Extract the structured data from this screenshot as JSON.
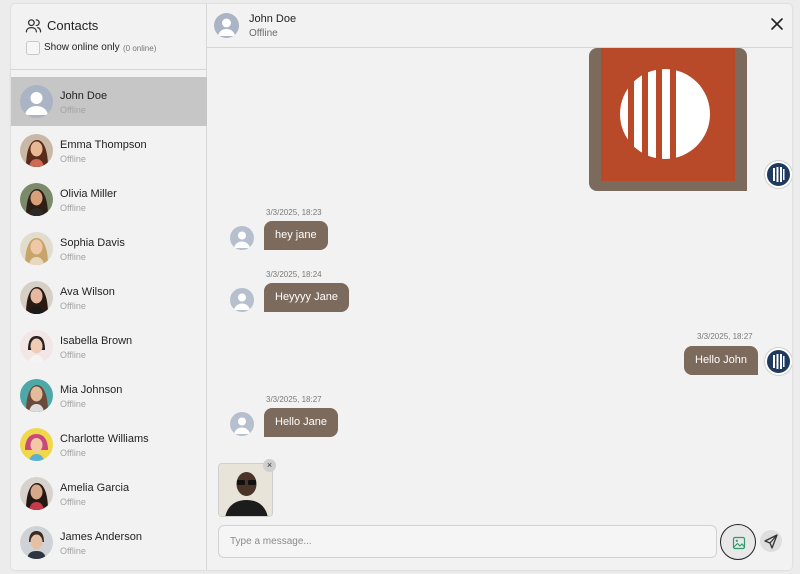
{
  "sidebar": {
    "title": "Contacts",
    "filter_label": "Show online only",
    "online_count": "(0 online)",
    "contacts": [
      {
        "name": "John Doe",
        "status": "Offline"
      },
      {
        "name": "Emma Thompson",
        "status": "Offline"
      },
      {
        "name": "Olivia Miller",
        "status": "Offline"
      },
      {
        "name": "Sophia Davis",
        "status": "Offline"
      },
      {
        "name": "Ava Wilson",
        "status": "Offline"
      },
      {
        "name": "Isabella Brown",
        "status": "Offline"
      },
      {
        "name": "Mia Johnson",
        "status": "Offline"
      },
      {
        "name": "Charlotte Williams",
        "status": "Offline"
      },
      {
        "name": "Amelia Garcia",
        "status": "Offline"
      },
      {
        "name": "James Anderson",
        "status": "Offline"
      }
    ]
  },
  "chat": {
    "name": "John Doe",
    "status": "Offline",
    "messages": [
      {
        "time": "3/3/2025, 18:23",
        "text": "hey jane"
      },
      {
        "time": "3/3/2025, 18:24",
        "text": "Heyyyy Jane"
      },
      {
        "time": "3/3/2025, 18:27",
        "text": "Hello John"
      },
      {
        "time": "3/3/2025, 18:27",
        "text": "Hello Jane"
      }
    ],
    "input_placeholder": "Type a message...",
    "remove_label": "×"
  },
  "colors": {
    "bubble": "#7c6a5c",
    "active_contact": "#c6c6c6",
    "brand_dark": "#1f3a5e",
    "image_red": "#b84a2a"
  }
}
